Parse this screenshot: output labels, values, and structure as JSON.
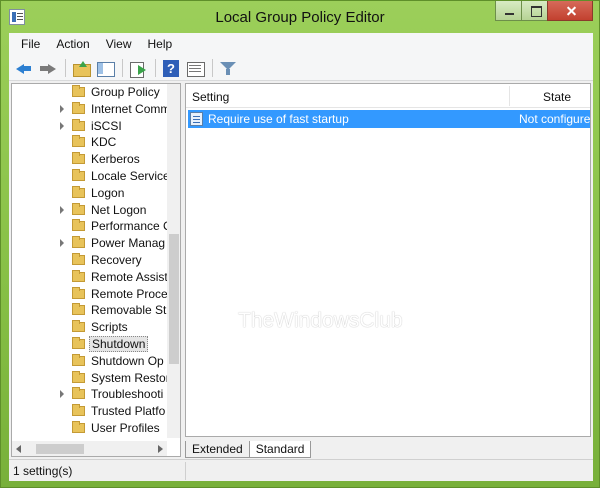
{
  "window": {
    "title": "Local Group Policy Editor"
  },
  "menu": {
    "items": [
      "File",
      "Action",
      "View",
      "Help"
    ]
  },
  "toolbar": {
    "icons": [
      "back-arrow-icon",
      "forward-arrow-icon",
      "up-folder-icon",
      "show-hide-tree-icon",
      "export-list-icon",
      "help-icon",
      "properties-icon",
      "filter-icon"
    ]
  },
  "tree": {
    "items": [
      {
        "label": "Group Policy",
        "expandable": false,
        "selected": false
      },
      {
        "label": "Internet Comm",
        "expandable": true,
        "selected": false
      },
      {
        "label": "iSCSI",
        "expandable": true,
        "selected": false
      },
      {
        "label": "KDC",
        "expandable": false,
        "selected": false
      },
      {
        "label": "Kerberos",
        "expandable": false,
        "selected": false
      },
      {
        "label": "Locale Service",
        "expandable": false,
        "selected": false
      },
      {
        "label": "Logon",
        "expandable": false,
        "selected": false
      },
      {
        "label": "Net Logon",
        "expandable": true,
        "selected": false
      },
      {
        "label": "Performance C",
        "expandable": false,
        "selected": false
      },
      {
        "label": "Power Manag",
        "expandable": true,
        "selected": false
      },
      {
        "label": "Recovery",
        "expandable": false,
        "selected": false
      },
      {
        "label": "Remote Assist",
        "expandable": false,
        "selected": false
      },
      {
        "label": "Remote Proce",
        "expandable": false,
        "selected": false
      },
      {
        "label": "Removable St",
        "expandable": false,
        "selected": false
      },
      {
        "label": "Scripts",
        "expandable": false,
        "selected": false
      },
      {
        "label": "Shutdown",
        "expandable": false,
        "selected": true
      },
      {
        "label": "Shutdown Op",
        "expandable": false,
        "selected": false
      },
      {
        "label": "System Restor",
        "expandable": false,
        "selected": false
      },
      {
        "label": "Troubleshooti",
        "expandable": true,
        "selected": false
      },
      {
        "label": "Trusted Platfo",
        "expandable": false,
        "selected": false
      },
      {
        "label": "User Profiles",
        "expandable": false,
        "selected": false
      }
    ]
  },
  "list": {
    "columns": {
      "setting": "Setting",
      "state": "State"
    },
    "rows": [
      {
        "setting": "Require use of fast startup",
        "state": "Not configured",
        "selected": true
      }
    ]
  },
  "tabs": [
    "Extended",
    "Standard"
  ],
  "active_tab": "Standard",
  "status": {
    "text": "1 setting(s)"
  },
  "watermark": {
    "text": "TheWindowsClub"
  },
  "colors": {
    "selection": "#3399ff",
    "frame_accent": "#86bf45"
  }
}
